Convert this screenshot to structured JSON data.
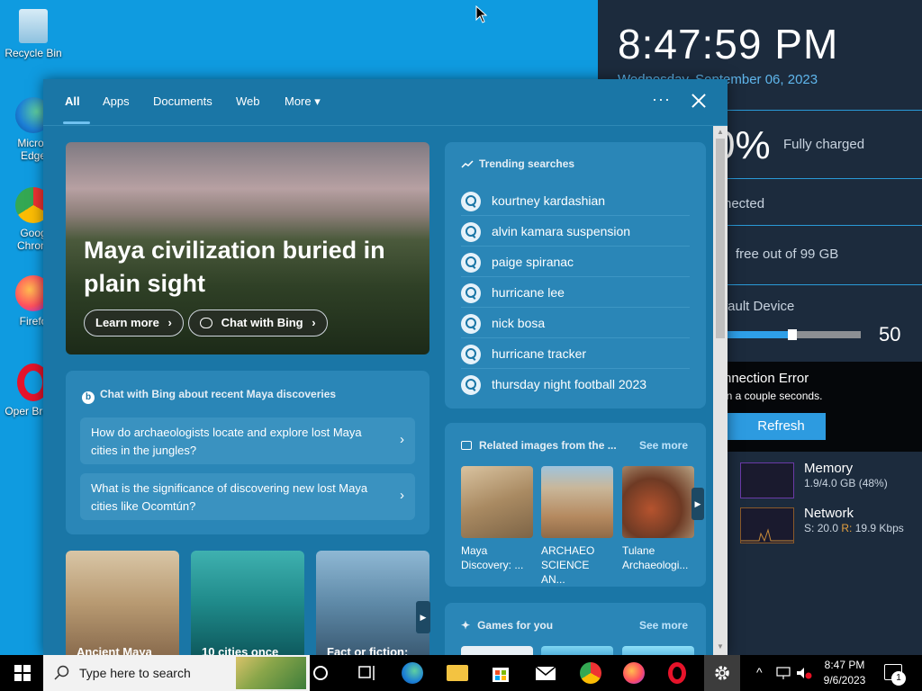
{
  "desktop": {
    "icons": [
      {
        "label": "Recycle Bin"
      },
      {
        "label": "Micros Edge"
      },
      {
        "label": "Goog Chrom"
      },
      {
        "label": "Firefo"
      },
      {
        "label": "Oper Brows"
      }
    ]
  },
  "gadget": {
    "time": "8:47:59 PM",
    "date": "Wednesday, September 06, 2023",
    "battery_percent": "0%",
    "battery_status": "Fully charged",
    "network_status": "nected",
    "disk_free": "free out of 99 GB",
    "audio_device": "fault Device",
    "volume_value": "50",
    "volume_level": 0.5,
    "weather_error_title": "nnection Error",
    "weather_error_msg": "in a couple seconds.",
    "refresh_label": "Refresh",
    "memory_label": "Memory",
    "memory_value": "1.9/4.0 GB (48%)",
    "network_label": "Network",
    "network_s_label": "S:",
    "network_s_value": "20.0",
    "network_r_label": "R:",
    "network_r_value": "19.9 Kbps"
  },
  "search_flyout": {
    "tabs": {
      "all": "All",
      "apps": "Apps",
      "documents": "Documents",
      "web": "Web",
      "more": "More"
    },
    "more_caret": "▾",
    "overflow_icon": "···",
    "hero": {
      "title": "Maya civilization buried in plain sight",
      "learn_more": "Learn more",
      "chat_with_bing": "Chat with Bing",
      "chevron": "›"
    },
    "trending": {
      "header": "Trending searches",
      "items": [
        "kourtney kardashian",
        "alvin kamara suspension",
        "paige spiranac",
        "hurricane lee",
        "nick bosa",
        "hurricane tracker",
        "thursday night football 2023"
      ]
    },
    "chat": {
      "header": "Chat with Bing about recent Maya discoveries",
      "questions": [
        "How do archaeologists locate and explore lost Maya cities in the jungles?",
        "What is the significance of discovering new lost Maya cities like Ocomtún?"
      ],
      "chevron": "›"
    },
    "related": {
      "header": "Related images from the ...",
      "see_more": "See more",
      "captions": [
        "Maya Discovery: ...",
        "ARCHAEO SCIENCE AN...",
        "Tulane Archaeologi..."
      ],
      "next_icon": "▶"
    },
    "tiles": [
      "Ancient Maya",
      "10 cities once",
      "Fact or fiction:"
    ],
    "tiles_next_icon": "▶",
    "games": {
      "header": "Games for you",
      "see_more": "See more"
    },
    "scroll_up": "▲",
    "scroll_down": "▼"
  },
  "taskbar": {
    "search_placeholder": "Type here to search",
    "clock_time": "8:47 PM",
    "clock_date": "9/6/2023",
    "tray_up": "^",
    "notification_count": "1"
  }
}
